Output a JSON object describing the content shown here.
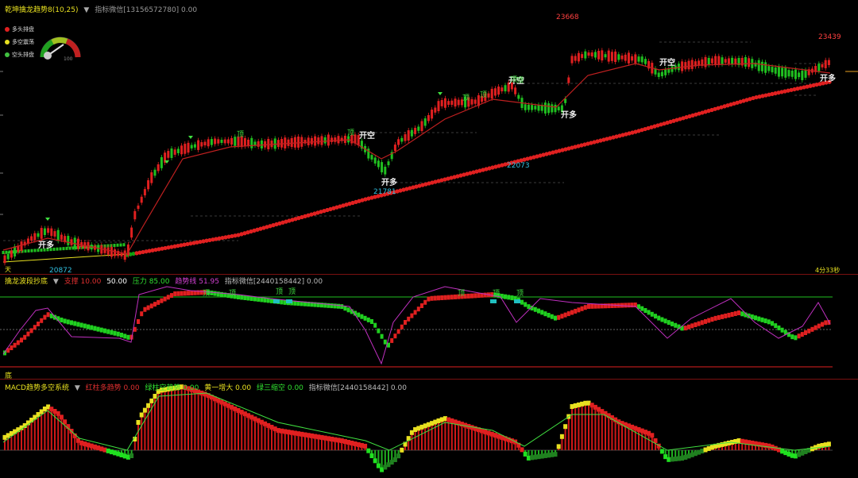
{
  "main": {
    "title": "乾坤擒龙趋势8(10,25)",
    "dropdown": "▼",
    "wechat": "指标微信[13156572780] 0.00",
    "legend": [
      {
        "label": "多头排盘",
        "color": "#e02020"
      },
      {
        "label": "多空震荡",
        "color": "#e8e020"
      },
      {
        "label": "空头排盘",
        "color": "#40c040"
      }
    ],
    "gauge_label": "100",
    "price_labels": {
      "high": "23668",
      "right_high": "23439",
      "mid": "22073",
      "low1": "21781",
      "low0": "20872"
    },
    "signals": {
      "long": "开多",
      "short": "开空",
      "top": "顶"
    },
    "footer_left": "天",
    "footer_right": "4分33秒"
  },
  "osc": {
    "title": "擒龙波段抄底",
    "values": [
      {
        "text": "支撑 10.00",
        "color": "#e03030"
      },
      {
        "text": "50.00",
        "color": "#ffffff"
      },
      {
        "text": "压力 85.00",
        "color": "#30e030"
      },
      {
        "text": "趋势线 51.95",
        "color": "#d040d0"
      },
      {
        "text": "指标微信[2440158442] 0.00",
        "color": "#bbbbbb"
      }
    ],
    "top_marks": [
      "顶",
      "顶",
      "顶",
      "顶",
      "顶",
      "顶",
      "顶"
    ],
    "bottom_label": "底"
  },
  "macd": {
    "title": "MACD趋势多空系统",
    "values": [
      {
        "text": "红柱多趋势 0.00",
        "color": "#e03030"
      },
      {
        "text": "绿柱空趋势 0.00",
        "color": "#30e030"
      },
      {
        "text": "黄一增大 0.00",
        "color": "#e8e020"
      },
      {
        "text": "绿三缩空 0.00",
        "color": "#30e030"
      },
      {
        "text": "指标微信[2440158442] 0.00",
        "color": "#bbbbbb"
      }
    ]
  }
}
